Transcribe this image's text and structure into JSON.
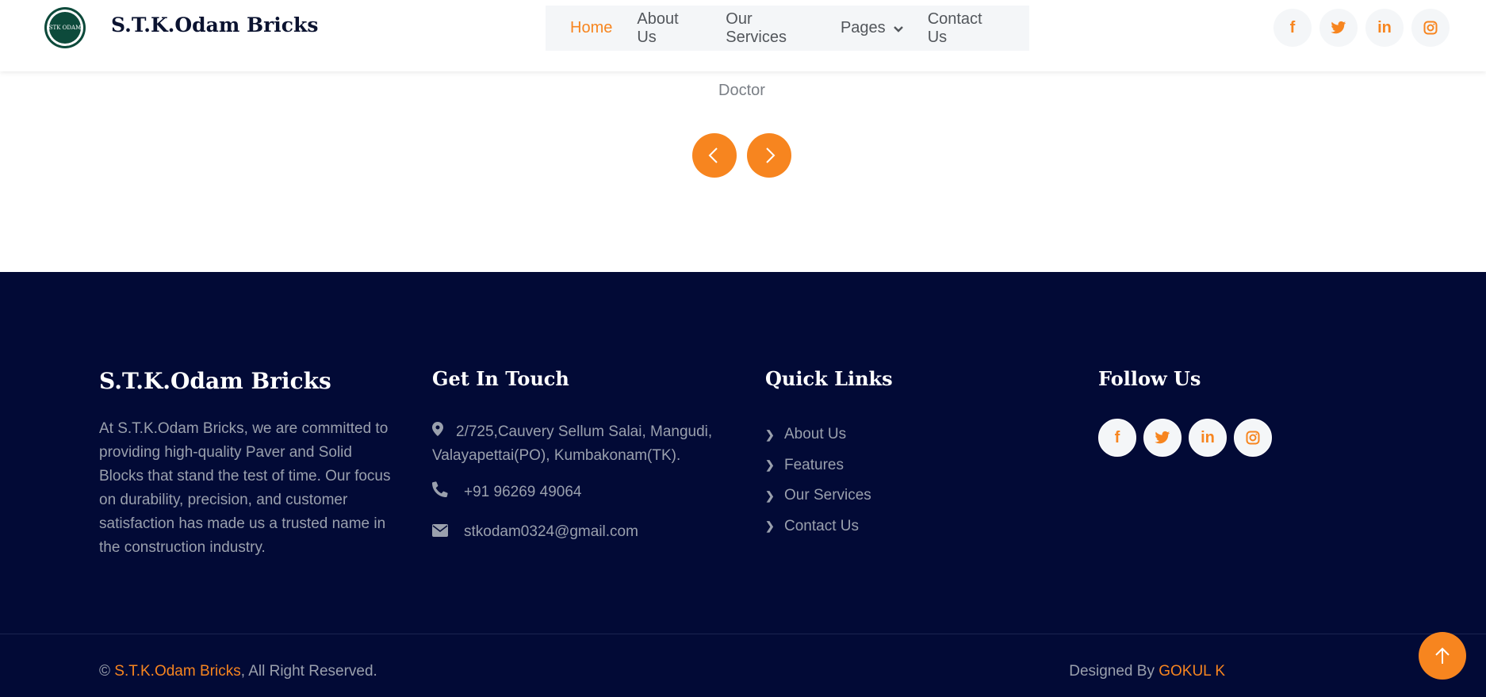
{
  "header": {
    "logo_text": "STK ODAM",
    "brand": "S.T.K.Odam Bricks",
    "nav": [
      {
        "label": "Home",
        "active": true
      },
      {
        "label": "About Us"
      },
      {
        "label": "Our Services"
      },
      {
        "label": "Pages",
        "dropdown": true
      },
      {
        "label": "Contact Us"
      }
    ],
    "social": [
      {
        "icon": "facebook-icon",
        "glyph": "f"
      },
      {
        "icon": "twitter-icon",
        "glyph": "🐦"
      },
      {
        "icon": "linkedin-icon",
        "glyph": "in"
      },
      {
        "icon": "instagram-icon",
        "glyph": "◎"
      }
    ]
  },
  "testimonial": {
    "role": "Doctor"
  },
  "footer": {
    "brand": "S.T.K.Odam Bricks",
    "about": "At S.T.K.Odam Bricks, we are committed to providing high-quality Paver and Solid Blocks that stand the test of time. Our focus on durability, precision, and customer satisfaction has made us a trusted name in the construction industry.",
    "get_in_touch": {
      "title": "Get In Touch",
      "address": "2/725,Cauvery Sellum Salai, Mangudi, Valayapettai(PO), Kumbakonam(TK).",
      "phone": "+91 96269 49064",
      "email": "stkodam0324@gmail.com"
    },
    "quick_links": {
      "title": "Quick Links",
      "items": [
        "About Us",
        "Features",
        "Our Services",
        "Contact Us"
      ]
    },
    "follow_us": {
      "title": "Follow Us"
    },
    "copyright": {
      "prefix": "© ",
      "brand": "S.T.K.Odam Bricks",
      "suffix": ", All Right Reserved."
    },
    "designed": {
      "prefix": "Designed By ",
      "author": "GOKUL K"
    }
  },
  "colors": {
    "accent": "#f7851f",
    "footer_bg": "#020a36"
  }
}
